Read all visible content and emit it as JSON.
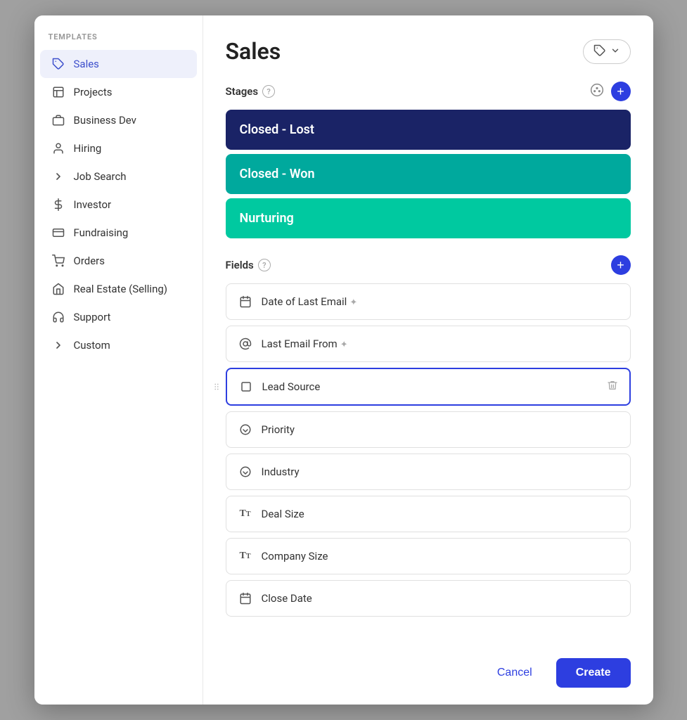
{
  "sidebar": {
    "header": "TEMPLATES",
    "items": [
      {
        "id": "sales",
        "label": "Sales",
        "icon": "🏷",
        "active": true
      },
      {
        "id": "projects",
        "label": "Projects",
        "icon": "📋",
        "active": false
      },
      {
        "id": "business-dev",
        "label": "Business Dev",
        "icon": "💼",
        "active": false
      },
      {
        "id": "hiring",
        "label": "Hiring",
        "icon": "👤",
        "active": false
      },
      {
        "id": "job-search",
        "label": "Job Search",
        "icon": "❯",
        "active": false
      },
      {
        "id": "investor",
        "label": "Investor",
        "icon": "$",
        "active": false
      },
      {
        "id": "fundraising",
        "label": "Fundraising",
        "icon": "🏦",
        "active": false
      },
      {
        "id": "orders",
        "label": "Orders",
        "icon": "🛒",
        "active": false
      },
      {
        "id": "real-estate",
        "label": "Real Estate (Selling)",
        "icon": "🏠",
        "active": false
      },
      {
        "id": "support",
        "label": "Support",
        "icon": "🎧",
        "active": false
      },
      {
        "id": "custom",
        "label": "Custom",
        "icon": "❯",
        "active": false
      }
    ]
  },
  "main": {
    "title": "Sales",
    "tag_button_label": "▷",
    "stages_section": {
      "label": "Stages",
      "stages": [
        {
          "id": "closed-lost",
          "label": "Closed - Lost",
          "color_class": "stage-closed-lost"
        },
        {
          "id": "closed-won",
          "label": "Closed - Won",
          "color_class": "stage-closed-won"
        },
        {
          "id": "nurturing",
          "label": "Nurturing",
          "color_class": "stage-nurturing"
        }
      ]
    },
    "fields_section": {
      "label": "Fields",
      "fields": [
        {
          "id": "date-of-last-email",
          "label": "Date of Last Email",
          "icon_type": "calendar",
          "has_sparkle": true,
          "is_dragging": false,
          "show_delete": false
        },
        {
          "id": "last-email-from",
          "label": "Last Email From",
          "icon_type": "at",
          "has_sparkle": true,
          "is_dragging": false,
          "show_delete": false
        },
        {
          "id": "lead-source",
          "label": "Lead Source",
          "icon_type": "square",
          "has_sparkle": false,
          "is_dragging": true,
          "show_delete": true
        },
        {
          "id": "priority",
          "label": "Priority",
          "icon_type": "circle-down",
          "has_sparkle": false,
          "is_dragging": false,
          "show_delete": false
        },
        {
          "id": "industry",
          "label": "Industry",
          "icon_type": "circle-down",
          "has_sparkle": false,
          "is_dragging": false,
          "show_delete": false
        },
        {
          "id": "deal-size",
          "label": "Deal Size",
          "icon_type": "text",
          "has_sparkle": false,
          "is_dragging": false,
          "show_delete": false
        },
        {
          "id": "company-size",
          "label": "Company Size",
          "icon_type": "text",
          "has_sparkle": false,
          "is_dragging": false,
          "show_delete": false
        },
        {
          "id": "close-date",
          "label": "Close Date",
          "icon_type": "calendar",
          "has_sparkle": false,
          "is_dragging": false,
          "show_delete": false
        }
      ]
    },
    "footer": {
      "cancel_label": "Cancel",
      "create_label": "Create"
    }
  },
  "icons": {
    "calendar": "📅",
    "at": "@",
    "square": "⬜",
    "circle-down": "⊙",
    "text": "Tt",
    "help": "?",
    "palette": "🎨",
    "tag": "🏷",
    "chevron-down": "▾",
    "dots": "⠿",
    "trash": "🗑"
  }
}
